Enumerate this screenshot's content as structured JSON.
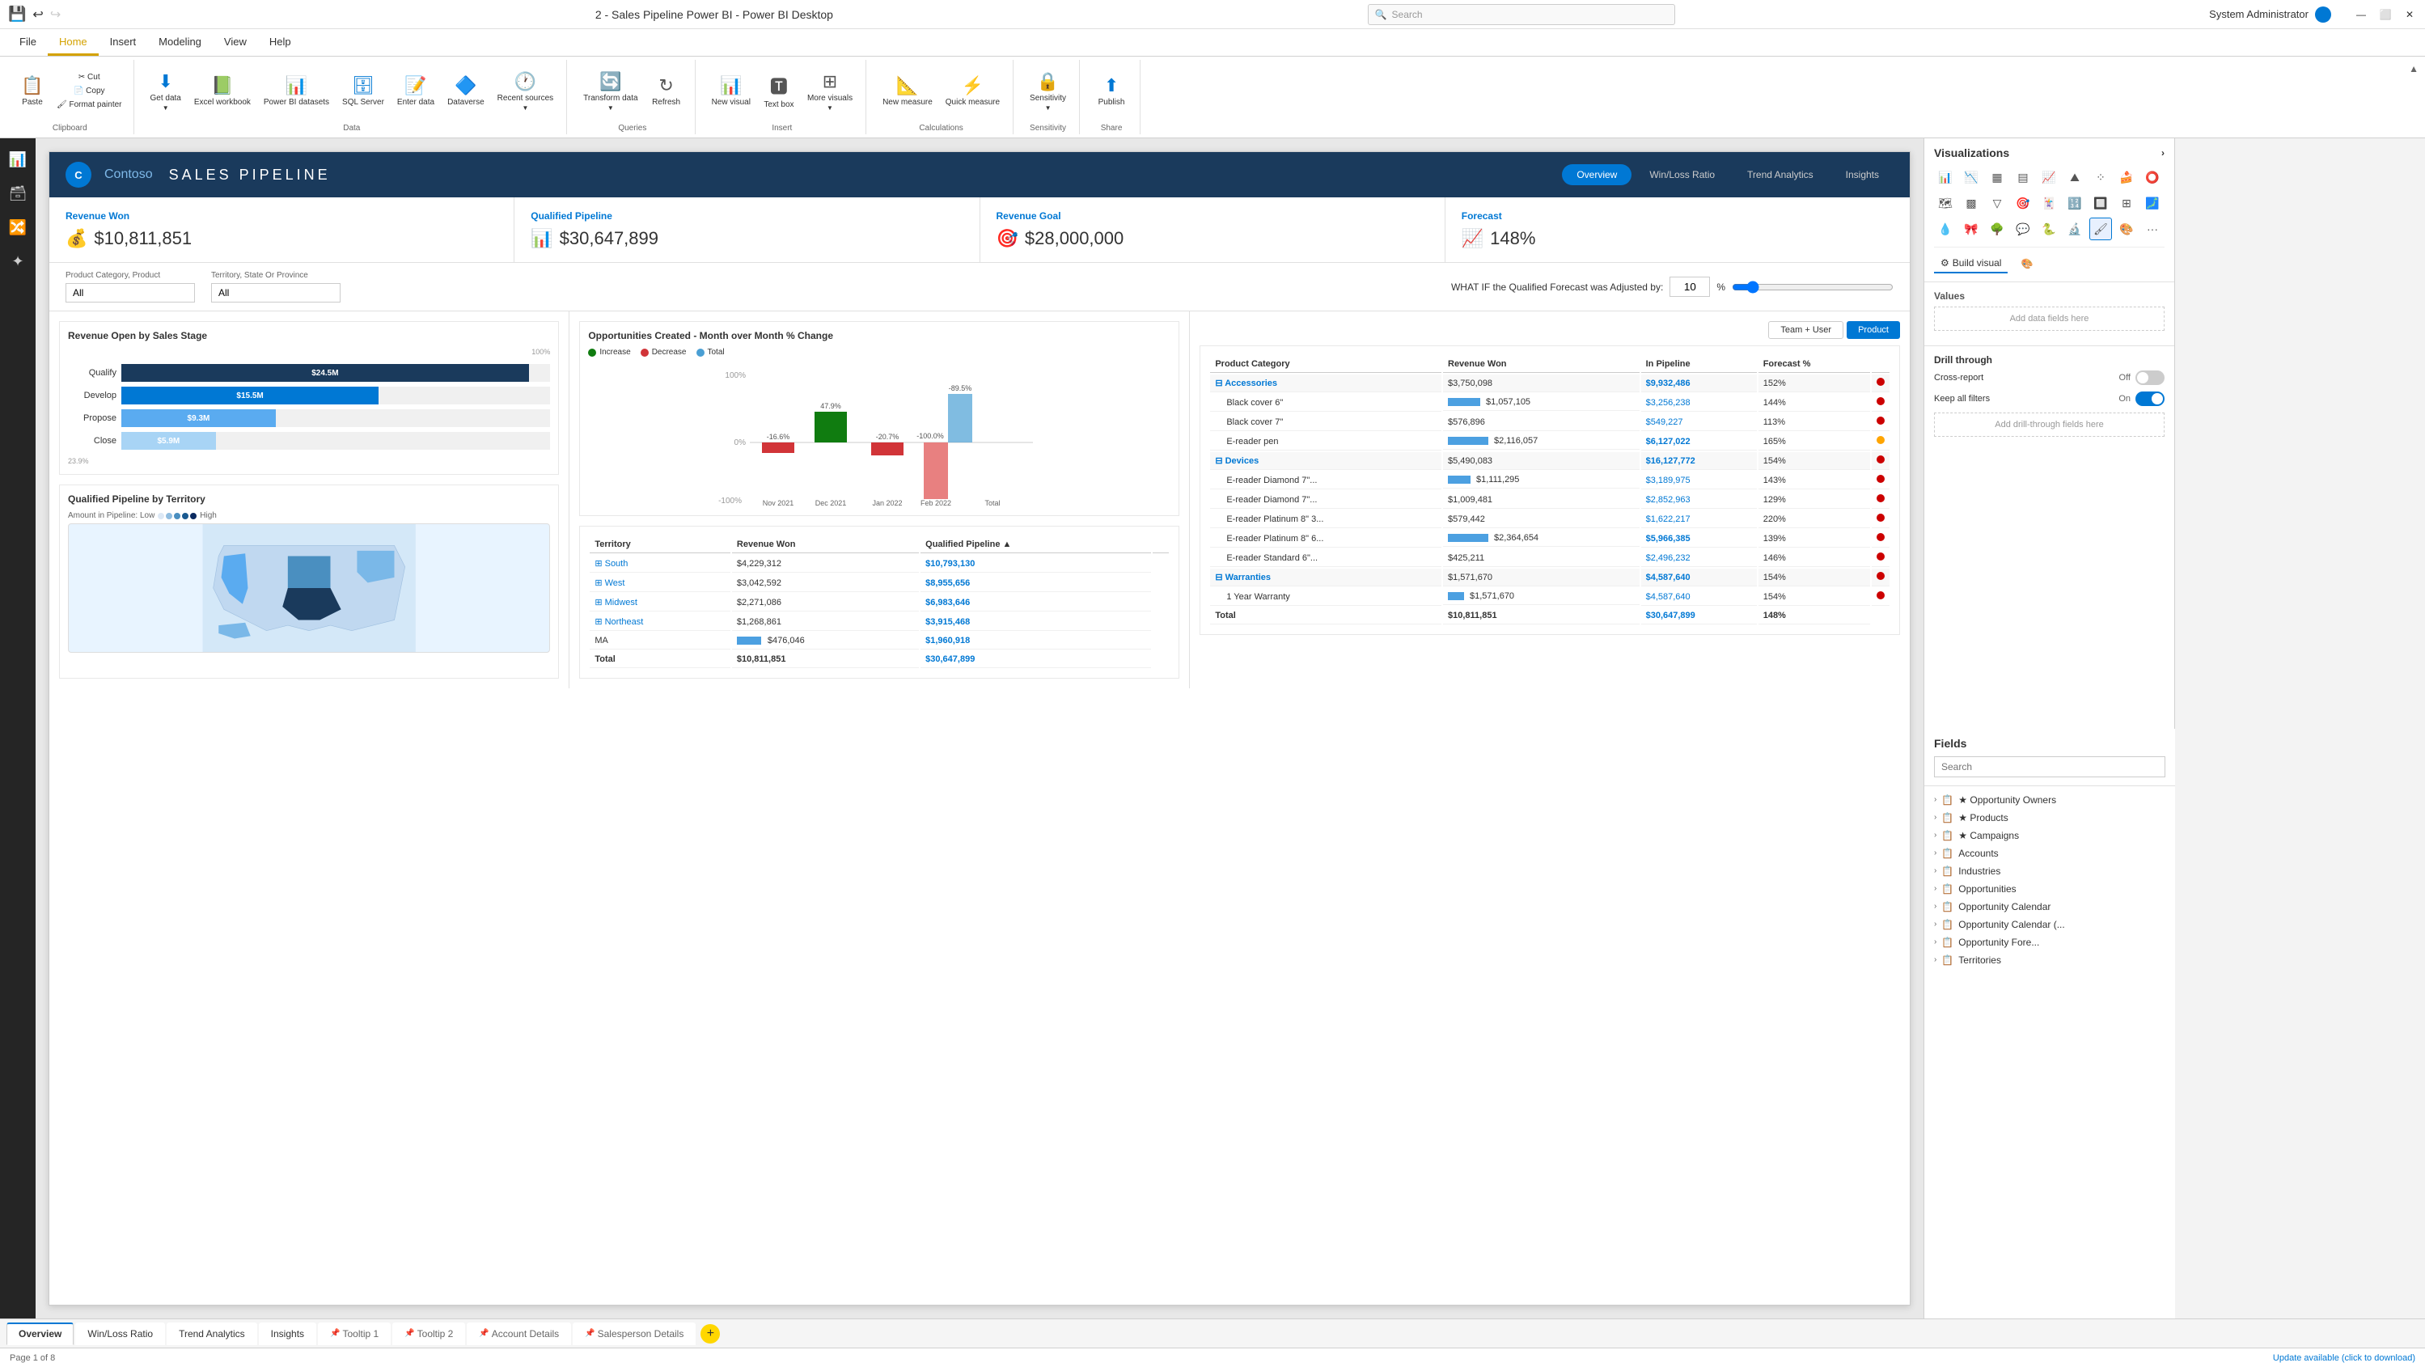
{
  "titleBar": {
    "title": "2 - Sales Pipeline Power BI - Power BI Desktop",
    "search": "Search",
    "user": "System Administrator"
  },
  "ribbonTabs": [
    "File",
    "Home",
    "Insert",
    "Modeling",
    "View",
    "Help"
  ],
  "activeTab": "Home",
  "ribbonGroups": {
    "clipboard": {
      "label": "Clipboard",
      "buttons": [
        "Paste",
        "Cut",
        "Copy",
        "Format painter"
      ]
    },
    "data": {
      "label": "Data",
      "buttons": [
        "Get data",
        "Excel workbook",
        "Power BI datasets",
        "SQL Server",
        "Enter data",
        "Dataverse",
        "Recent sources"
      ]
    },
    "queries": {
      "label": "Queries",
      "buttons": [
        "Transform data",
        "Refresh"
      ]
    },
    "insert": {
      "label": "Insert",
      "buttons": [
        "New visual",
        "Text box",
        "More visuals"
      ]
    },
    "calculations": {
      "label": "Calculations",
      "buttons": [
        "New measure",
        "Quick measure"
      ]
    },
    "sensitivity": {
      "label": "Sensitivity",
      "buttons": [
        "Sensitivity"
      ]
    },
    "share": {
      "label": "Share",
      "buttons": [
        "Publish"
      ]
    }
  },
  "report": {
    "logo": "C",
    "company": "Contoso",
    "title": "SALES PIPELINE",
    "navButtons": [
      "Overview",
      "Win/Loss Ratio",
      "Trend Analytics",
      "Insights"
    ],
    "activeNav": "Overview"
  },
  "kpis": [
    {
      "label": "Revenue Won",
      "value": "$10,811,851",
      "icon": "💰"
    },
    {
      "label": "Qualified Pipeline",
      "value": "$30,647,899",
      "icon": "📊"
    },
    {
      "label": "Revenue Goal",
      "value": "$28,000,000",
      "icon": "🎯"
    },
    {
      "label": "Forecast",
      "value": "148%",
      "icon": "📈"
    }
  ],
  "filters": {
    "productFilter": {
      "label": "Product Category, Product",
      "value": "All"
    },
    "territoryFilter": {
      "label": "Territory, State Or Province",
      "value": "All"
    },
    "whatIf": {
      "label": "WHAT IF the Qualified Forecast was Adjusted by:",
      "value": "10",
      "unit": "%"
    }
  },
  "barChart": {
    "title": "Revenue Open by Sales Stage",
    "bars": [
      {
        "label": "Qualify",
        "value": "$24.5M",
        "pct": 95
      },
      {
        "label": "Develop",
        "value": "$15.5M",
        "pct": 60
      },
      {
        "label": "Propose",
        "value": "$9.3M",
        "pct": 36
      },
      {
        "label": "Close",
        "value": "$5.9M",
        "pct": 22
      }
    ],
    "maxLabel": "100%",
    "minLabel": "23.9%"
  },
  "momChart": {
    "title": "Opportunities Created - Month over Month % Change",
    "legend": [
      "Increase",
      "Decrease",
      "Total"
    ],
    "months": [
      "Nov 2021",
      "Dec 2021",
      "Jan 2022",
      "Feb 2022",
      "Total"
    ],
    "bars": [
      {
        "month": "Nov 2021",
        "type": "decrease",
        "value": -16.6
      },
      {
        "month": "Dec 2021",
        "type": "increase",
        "value": 47.9
      },
      {
        "month": "Jan 2022",
        "type": "decrease",
        "value": -20.7
      },
      {
        "month": "Feb 2022",
        "type": "decrease",
        "value": -100.0
      },
      {
        "month": "Total",
        "type": "total",
        "value": -89.5
      }
    ]
  },
  "territoryTable": {
    "title": "Territory",
    "columns": [
      "Territory",
      "Revenue Won",
      "Qualified Pipeline"
    ],
    "rows": [
      {
        "name": "South",
        "revWon": "$4,229,312",
        "qualPipeline": "$10,793,130",
        "barWidth": 60
      },
      {
        "name": "West",
        "revWon": "$3,042,592",
        "qualPipeline": "$8,955,656",
        "barWidth": 50
      },
      {
        "name": "Midwest",
        "revWon": "$2,271,086",
        "qualPipeline": "$6,983,646",
        "barWidth": 40
      },
      {
        "name": "Northeast",
        "revWon": "$1,268,861",
        "qualPipeline": "$3,915,468",
        "barWidth": 22
      },
      {
        "name": "MA",
        "revWon": "$476,046",
        "qualPipeline": "$1,960,918",
        "barWidth": 11
      }
    ],
    "totals": {
      "label": "Total",
      "revWon": "$10,811,851",
      "qualPipeline": "$30,647,899"
    }
  },
  "productTable": {
    "columns": [
      "Product Category",
      "Revenue Won",
      "In Pipeline",
      "Forecast %"
    ],
    "categories": [
      {
        "name": "Accessories",
        "revWon": "$3,750,098",
        "inPipeline": "$9,932,486",
        "forecastPct": "152%",
        "dotColor": "#cc0000",
        "products": [
          {
            "name": "Black cover 6\"",
            "revWon": "$1,057,105",
            "inPipeline": "$3,256,238",
            "forecastPct": "144%",
            "dotColor": "#cc0000"
          },
          {
            "name": "Black cover 7\"",
            "revWon": "$576,896",
            "inPipeline": "$549,227",
            "forecastPct": "113%",
            "dotColor": "#cc0000"
          },
          {
            "name": "E-reader pen",
            "revWon": "$2,116,057",
            "inPipeline": "$6,127,022",
            "forecastPct": "165%",
            "dotColor": "#ffa500"
          }
        ]
      },
      {
        "name": "Devices",
        "revWon": "$5,490,083",
        "inPipeline": "$16,127,772",
        "forecastPct": "154%",
        "dotColor": "#cc0000",
        "products": [
          {
            "name": "E-reader Diamond 7\"...",
            "revWon": "$1,111,295",
            "inPipeline": "$3,189,975",
            "forecastPct": "143%",
            "dotColor": "#cc0000"
          },
          {
            "name": "E-reader Diamond 7\"...",
            "revWon": "$1,009,481",
            "inPipeline": "$2,852,963",
            "forecastPct": "129%",
            "dotColor": "#cc0000"
          },
          {
            "name": "E-reader Platinum 8\" 3...",
            "revWon": "$579,442",
            "inPipeline": "$1,622,217",
            "forecastPct": "220%",
            "dotColor": "#cc0000"
          },
          {
            "name": "E-reader Platinum 8\" 6...",
            "revWon": "$2,364,654",
            "inPipeline": "$5,966,385",
            "forecastPct": "139%",
            "dotColor": "#cc0000"
          },
          {
            "name": "E-reader Standard 6\"...",
            "revWon": "$425,211",
            "inPipeline": "$2,496,232",
            "forecastPct": "146%",
            "dotColor": "#cc0000"
          }
        ]
      },
      {
        "name": "Warranties",
        "revWon": "$1,571,670",
        "inPipeline": "$4,587,640",
        "forecastPct": "154%",
        "dotColor": "#cc0000",
        "products": [
          {
            "name": "1 Year Warranty",
            "revWon": "$1,571,670",
            "inPipeline": "$4,587,640",
            "forecastPct": "154%",
            "dotColor": "#cc0000"
          }
        ]
      }
    ],
    "totals": {
      "label": "Total",
      "revWon": "$10,811,851",
      "inPipeline": "$30,647,899",
      "forecastPct": "148%"
    }
  },
  "visualizationsPanel": {
    "title": "Visualizations",
    "vizIcons": [
      "📊",
      "📈",
      "🗺",
      "📉",
      "🔲",
      "📋",
      "🔴",
      "🔷",
      "🌐",
      "🔢",
      "📌",
      "📍",
      "🔑",
      "🎯",
      "📡",
      "🔵",
      "🟦",
      "🟩",
      "🔶",
      "🔸",
      "🔹",
      "💡",
      "🎪",
      "📐",
      "🔧",
      "📎",
      "📌",
      "🎨",
      "🔍",
      "📦"
    ],
    "valuesLabel": "Values",
    "addDataFields": "Add data fields here",
    "drillThrough": {
      "title": "Drill through",
      "crossReport": "Cross-report",
      "crossReportToggle": "off",
      "keepFilters": "Keep all filters",
      "keepFiltersToggle": "on",
      "addDrillFields": "Add drill-through fields here"
    }
  },
  "fieldsPanel": {
    "title": "Fields",
    "searchPlaceholder": "Search",
    "groups": [
      {
        "name": "Opportunity Owners",
        "icon": "★"
      },
      {
        "name": "Products",
        "icon": "★"
      },
      {
        "name": "Campaigns",
        "icon": "★"
      },
      {
        "name": "Accounts",
        "icon": "📋"
      },
      {
        "name": "Industries",
        "icon": "📋"
      },
      {
        "name": "Opportunities",
        "icon": "📋"
      },
      {
        "name": "Opportunity Calendar",
        "icon": "📋"
      },
      {
        "name": "Opportunity Calendar (...",
        "icon": "📋"
      },
      {
        "name": "Opportunity Fore...",
        "icon": "📋"
      },
      {
        "name": "Territories",
        "icon": "📋"
      }
    ]
  },
  "pageTabs": [
    {
      "label": "Overview",
      "active": true,
      "tooltip": false
    },
    {
      "label": "Win/Loss Ratio",
      "active": false,
      "tooltip": false
    },
    {
      "label": "Trend Analytics",
      "active": false,
      "tooltip": false
    },
    {
      "label": "Insights",
      "active": false,
      "tooltip": false
    },
    {
      "label": "Tooltip 1",
      "active": false,
      "tooltip": true
    },
    {
      "label": "Tooltip 2",
      "active": false,
      "tooltip": true
    },
    {
      "label": "Account Details",
      "active": false,
      "tooltip": true
    },
    {
      "label": "Salesperson Details",
      "active": false,
      "tooltip": true
    }
  ],
  "statusBar": {
    "pageInfo": "Page 1 of 8",
    "updateMessage": "Update available (click to download)"
  },
  "mapChart": {
    "title": "Qualified Pipeline by Territory",
    "subtitle": "Amount in Pipeline: Low",
    "legend": "High"
  }
}
